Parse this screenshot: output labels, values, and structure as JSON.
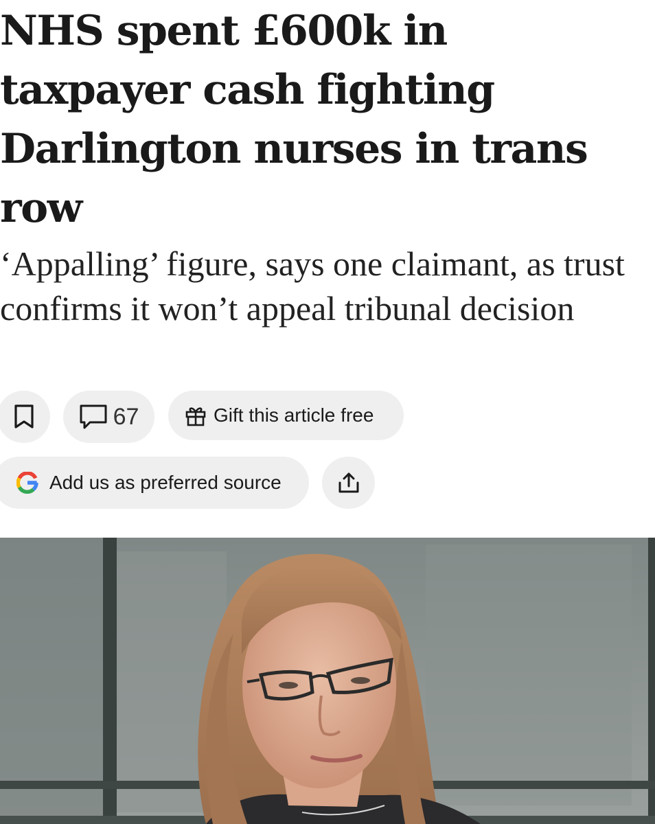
{
  "article": {
    "headline": "NHS spent £600k in taxpayer cash fighting Darlington nurses in trans row",
    "standfirst": "‘Appalling’ figure, says one claimant, as trust confirms it won’t appeal tribunal decision"
  },
  "actions": {
    "comment_count": "67",
    "gift_label": "Gift this article free",
    "preferred_source_label": "Add us as preferred source"
  },
  "icons": {
    "save": "bookmark-icon",
    "comments": "comment-bubble-icon",
    "gift": "gift-icon",
    "google": "google-logo-icon",
    "share": "share-icon"
  },
  "colors": {
    "pill_background": "#efefef",
    "text": "#1a1a1a"
  }
}
